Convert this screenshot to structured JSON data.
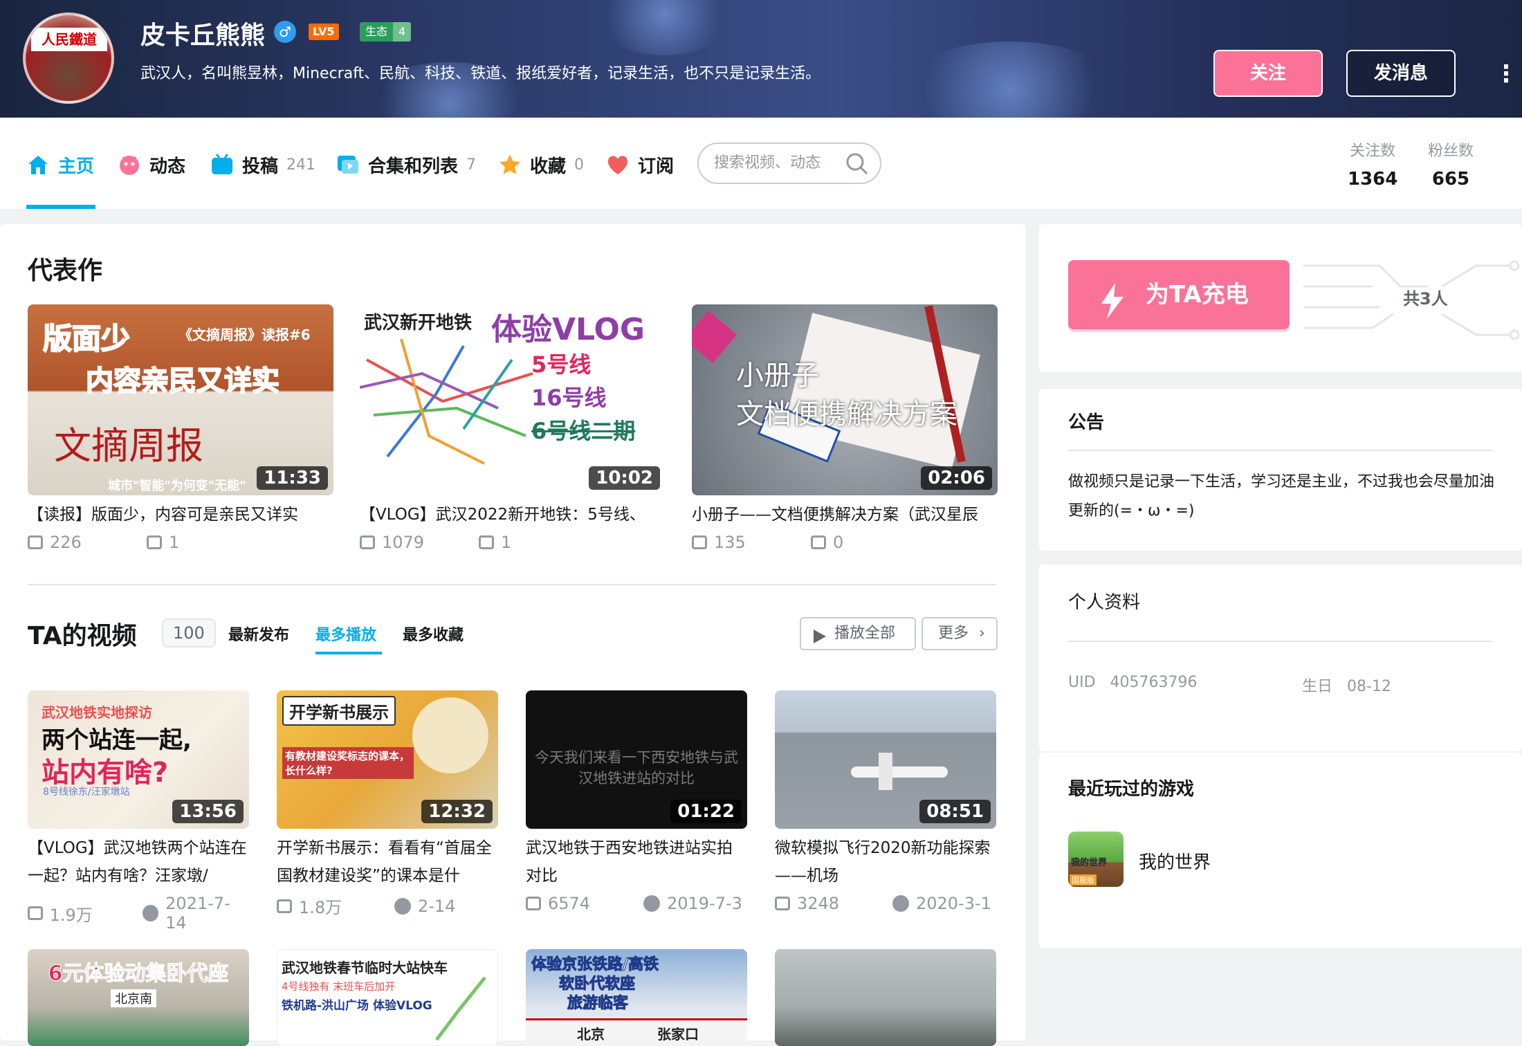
{
  "header": {
    "username": "皮卡丘熊熊",
    "gender_icon": "♂",
    "level": "LV5",
    "eco_label": "生态",
    "eco_value": "4",
    "signature": "武汉人，名叫熊昱林，Minecraft、民航、科技、铁道、报纸爱好者，记录生活，也不只是记录生活。",
    "avatar_text": "人民鐵道",
    "follow_label": "关注",
    "message_label": "发消息"
  },
  "nav": {
    "tabs": [
      {
        "label": "主页",
        "count": "",
        "icon": "home-icon"
      },
      {
        "label": "动态",
        "count": "",
        "icon": "dynamic-icon"
      },
      {
        "label": "投稿",
        "count": "241",
        "icon": "upload-icon"
      },
      {
        "label": "合集和列表",
        "count": "7",
        "icon": "collection-icon"
      },
      {
        "label": "收藏",
        "count": "0",
        "icon": "favorite-icon"
      },
      {
        "label": "订阅",
        "count": "",
        "icon": "heart-icon"
      }
    ],
    "search_placeholder": "搜索视频、动态",
    "following_label": "关注数",
    "following_value": "1364",
    "fans_label": "粉丝数",
    "fans_value": "665"
  },
  "masterpiece": {
    "title": "代表作",
    "items": [
      {
        "thumb_text1": "版面少",
        "thumb_text2": "《文摘周报》读报#6",
        "thumb_text3": "内容亲民又详实",
        "thumb_text4": "城市\"智能\"为何变\"无能\"",
        "duration": "11:33",
        "title": "【读报】版面少，内容可是亲民又详实",
        "plays": "226",
        "comments": "1"
      },
      {
        "thumb_text1": "武汉新开地铁",
        "thumb_text2": "体验VLOG",
        "thumb_text3": "5号线",
        "thumb_text4": "16号线",
        "thumb_text5": "6号线二期",
        "duration": "10:02",
        "title": "【VLOG】武汉2022新开地铁：5号线、",
        "plays": "1079",
        "comments": "1"
      },
      {
        "thumb_text1": "小册子",
        "thumb_text2": "文档便携解决方案",
        "duration": "02:06",
        "title": "小册子——文档便携解决方案（武汉星辰",
        "plays": "135",
        "comments": "0"
      }
    ]
  },
  "videos": {
    "title": "TA的视频",
    "count": "100",
    "sort_tabs": [
      "最新发布",
      "最多播放",
      "最多收藏"
    ],
    "play_all": "播放全部",
    "more": "更多",
    "items": [
      {
        "thumb_text1": "武汉地铁实地探访",
        "thumb_text2": "两个站连一起,",
        "thumb_text3": "站内有啥?",
        "thumb_text4": "8号线徐东/汪家墩站",
        "duration": "13:56",
        "title": "【VLOG】武汉地铁两个站连在一起？站内有啥？汪家墩/",
        "plays": "1.9万",
        "date": "2021-7-14"
      },
      {
        "thumb_text1": "开学新书展示",
        "thumb_text2": "有教材建设奖标志的课本，长什么样?",
        "duration": "12:32",
        "title": "开学新书展示：看看有“首届全国教材建设奖”的课本是什",
        "plays": "1.8万",
        "date": "2-14"
      },
      {
        "thumb_text1": "今天我们来看一下西安地铁与武汉地铁进站的对比",
        "duration": "01:22",
        "title": "武汉地铁于西安地铁进站实拍对比",
        "plays": "6574",
        "date": "2019-7-3"
      },
      {
        "thumb_text1": "",
        "duration": "08:51",
        "title": "微软模拟飞行2020新功能探索——机场",
        "plays": "3248",
        "date": "2020-3-1"
      },
      {
        "thumb_text1": "6元体验动集卧代座",
        "thumb_text2": "北京南",
        "duration": "",
        "title": "",
        "plays": "",
        "date": ""
      },
      {
        "thumb_text1": "武汉地铁春节临时大站快车",
        "thumb_text2": "4号线独有 末班车后加开",
        "thumb_text3": "铁机路-洪山广场 体验VLOG",
        "duration": "",
        "title": "",
        "plays": "",
        "date": ""
      },
      {
        "thumb_text1": "体验京张铁路/高铁",
        "thumb_text2": "软卧代软座",
        "thumb_text3": "旅游临客",
        "thumb_text4": "北京",
        "thumb_text5": "张家口",
        "duration": "",
        "title": "",
        "plays": "",
        "date": ""
      },
      {
        "thumb_text1": "",
        "duration": "",
        "title": "",
        "plays": "",
        "date": ""
      }
    ]
  },
  "sidebar": {
    "charge_label": "为TA充电",
    "charge_count": "共3人",
    "notice_title": "公告",
    "notice_text": "做视频只是记录一下生活，学习还是主业，不过我也会尽量加油更新的(=・ω・=)",
    "profile_title": "个人资料",
    "uid_label": "UID",
    "uid_value": "405763796",
    "birthday_label": "生日",
    "birthday_value": "08-12",
    "games_title": "最近玩过的游戏",
    "game_name": "我的世界",
    "game_icon_text": "我的世界",
    "game_icon_tag": "国服版"
  },
  "colors": {
    "accent": "#00aeec",
    "pink": "#fb7299",
    "text": "#18191c",
    "muted": "#9499a0"
  }
}
